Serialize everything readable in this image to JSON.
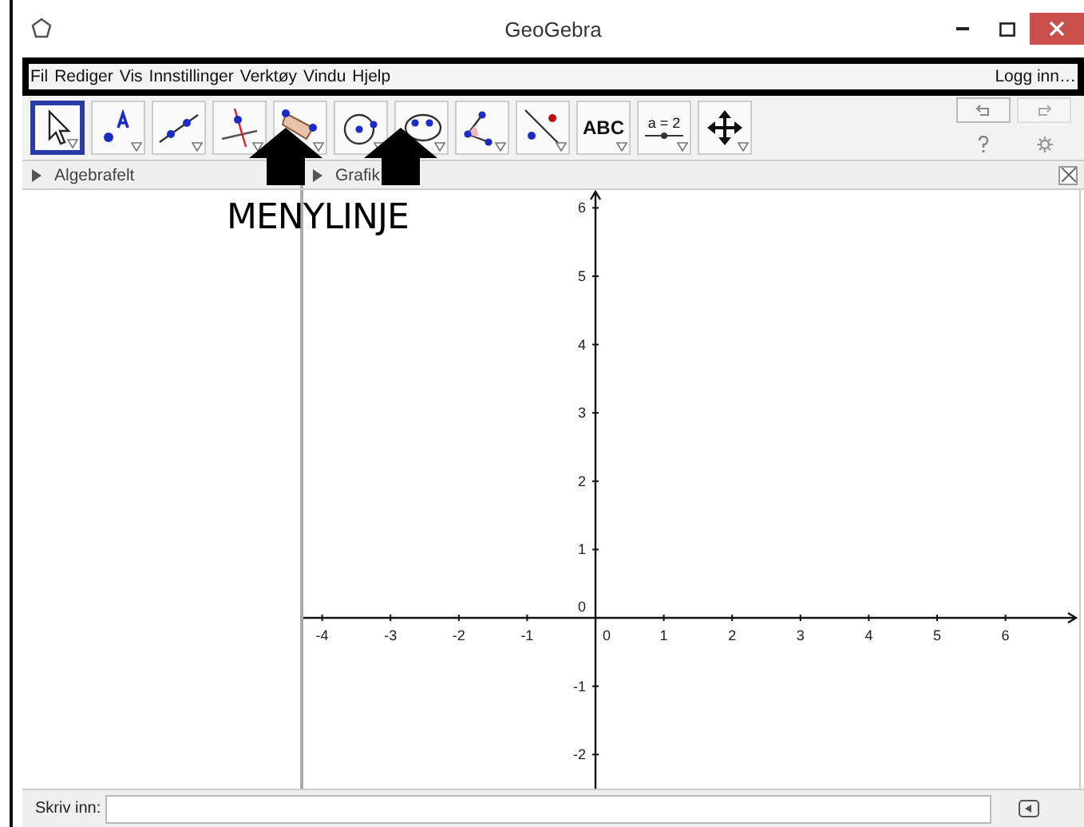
{
  "window": {
    "title": "GeoGebra"
  },
  "menu": {
    "items": [
      "Fil",
      "Rediger",
      "Vis",
      "Innstillinger",
      "Verktøy",
      "Vindu",
      "Hjelp"
    ],
    "login": "Logg inn…"
  },
  "toolbar": {
    "tools": [
      {
        "kind": "move",
        "selected": true
      },
      {
        "kind": "point",
        "selected": false
      },
      {
        "kind": "line",
        "selected": false
      },
      {
        "kind": "perpendicular",
        "selected": false
      },
      {
        "kind": "polygon",
        "selected": false
      },
      {
        "kind": "circle",
        "selected": false
      },
      {
        "kind": "ellipse",
        "selected": false
      },
      {
        "kind": "angle",
        "selected": false
      },
      {
        "kind": "reflect",
        "selected": false
      },
      {
        "kind": "text",
        "label": "ABC",
        "selected": false
      },
      {
        "kind": "slider",
        "label": "a = 2",
        "selected": false
      },
      {
        "kind": "pan",
        "selected": false
      }
    ]
  },
  "panels": {
    "algebra": {
      "title": "Algebrafelt"
    },
    "graphics": {
      "title": "Grafik"
    }
  },
  "graphics": {
    "x_ticks": [
      "-4",
      "-3",
      "-2",
      "-1",
      "0",
      "1",
      "2",
      "3",
      "4",
      "5",
      "6"
    ],
    "y_ticks": [
      "6",
      "5",
      "4",
      "3",
      "2",
      "1",
      "0",
      "-1",
      "-2"
    ]
  },
  "input_bar": {
    "label": "Skriv inn:"
  },
  "annotation": {
    "text": "MENYLINJE",
    "arrows": [
      {
        "kind": "up"
      },
      {
        "kind": "up"
      }
    ]
  }
}
